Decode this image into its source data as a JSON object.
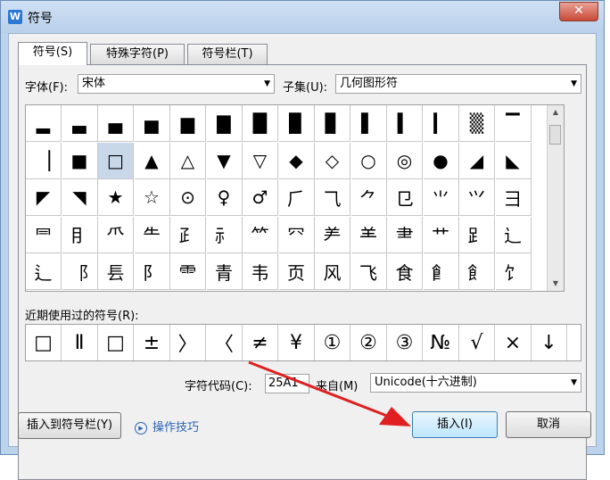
{
  "window": {
    "title": "符号",
    "icon_letter": "W"
  },
  "tabs": [
    {
      "label": "符号(S)",
      "active": true
    },
    {
      "label": "特殊字符(P)",
      "active": false
    },
    {
      "label": "符号栏(T)",
      "active": false
    }
  ],
  "font": {
    "label": "字体(F):",
    "value": "宋体"
  },
  "subset": {
    "label": "子集(U):",
    "value": "几何图形符"
  },
  "symbols": [
    [
      "▂",
      "▃",
      "▄",
      "▅",
      "▆",
      "▇",
      "█",
      "▉",
      "▊",
      "▌",
      "▍",
      "▎",
      "▒",
      "▔"
    ],
    [
      "▕",
      "■",
      "□",
      "▲",
      "△",
      "▼",
      "▽",
      "◆",
      "◇",
      "○",
      "◎",
      "●",
      "◢",
      "◣"
    ],
    [
      "◤",
      "◥",
      "★",
      "☆",
      "⊙",
      "♀",
      "♂",
      "⺁",
      "⺄",
      "⺈",
      "⺋",
      "⺌",
      "⺍",
      "⺕"
    ],
    [
      "⺜",
      "⺝",
      "⺥",
      "⺧",
      "⺪",
      "⺬",
      "⺮",
      "⺳",
      "⺶",
      "⺷",
      "⺻",
      "⺾",
      "⻊",
      "⻌"
    ],
    [
      "⻍",
      "⻏",
      "⻒",
      "⻖",
      "⻗",
      "⻘",
      "⻙",
      "⻚",
      "⻛",
      "⻜",
      "⻝",
      "⻞",
      "⻟",
      "⻠"
    ]
  ],
  "selected_symbol": "□",
  "recent": {
    "label": "近期使用过的符号(R):",
    "items": [
      "□",
      "Ⅱ",
      "□",
      "±",
      "〉",
      "〈",
      "≠",
      "¥",
      "①",
      "②",
      "③",
      "№",
      "√",
      "×",
      "↓"
    ]
  },
  "code": {
    "label": "字符代码(C):",
    "value": "25A1",
    "from_label": "来自(M)",
    "from_value": "Unicode(十六进制)"
  },
  "buttons": {
    "insert_to_bar": "插入到符号栏(Y)",
    "tips": "操作技巧",
    "insert": "插入(I)",
    "cancel": "取消"
  }
}
